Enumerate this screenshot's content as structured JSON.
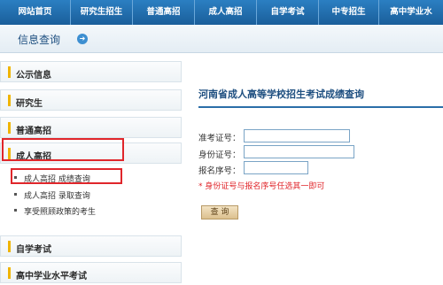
{
  "nav": [
    "网站首页",
    "研究生招生",
    "普通高招",
    "成人高招",
    "自学考试",
    "中专招生",
    "高中学业水"
  ],
  "subheader": {
    "title": "信息查询",
    "go_icon": "arrow-circle-icon"
  },
  "sidebar": {
    "headers": [
      "公示信息",
      "研究生",
      "普通高招",
      "成人高招"
    ],
    "sub_items": [
      "成人高招 成绩查询",
      "成人高招 录取查询",
      "享受照顾政策的考生"
    ],
    "footer_headers": [
      "自学考试",
      "高中学业水平考试"
    ]
  },
  "main": {
    "title": "河南省成人高等学校招生考试成绩查询",
    "fields": [
      {
        "label": "准考证号：",
        "value": ""
      },
      {
        "label": "身份证号：",
        "value": ""
      },
      {
        "label": "报名序号：",
        "value": ""
      }
    ],
    "note": "* 身份证号与报名序号任选其一即可",
    "submit_label": "查 询"
  },
  "colors": {
    "accent": "#1e4f80",
    "highlight": "#e0262b",
    "nav_bg": "#2b7fc2"
  }
}
